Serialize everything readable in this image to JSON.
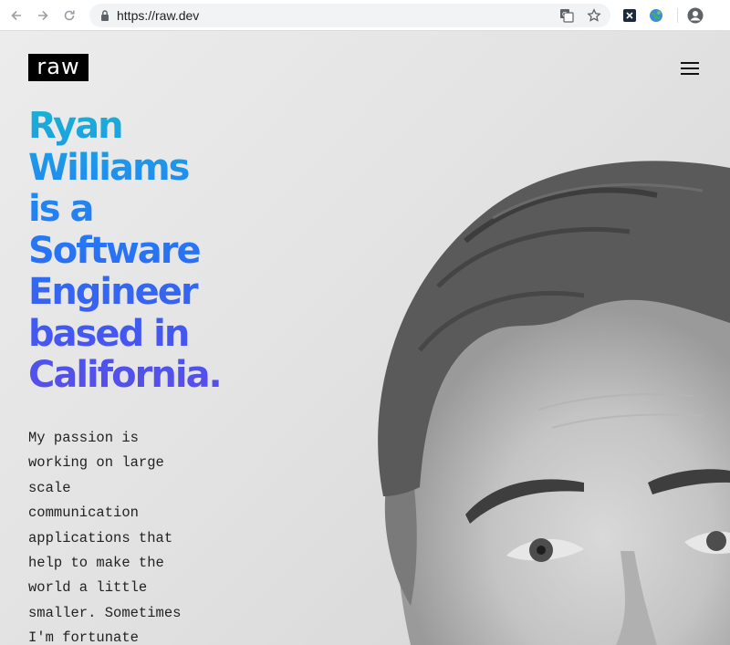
{
  "browser": {
    "url": "https://raw.dev"
  },
  "site": {
    "logo": "raw"
  },
  "hero": {
    "headline_lines": [
      "Ryan",
      "Williams",
      "is a",
      "Software",
      "Engineer",
      "based in",
      "California."
    ],
    "bio_lines": [
      "My passion is",
      "working on large",
      "scale",
      "communication",
      "applications that",
      "help to make the",
      "world a little",
      "smaller. Sometimes",
      "I'm fortunate"
    ]
  },
  "icons": {
    "back": "arrow-left-icon",
    "forward": "arrow-right-icon",
    "reload": "reload-icon",
    "lock": "lock-icon",
    "translate": "translate-icon",
    "bookmark": "star-icon",
    "extension1": "x-extension-icon",
    "extension2": "globe-extension-icon",
    "profile": "profile-icon",
    "menu": "hamburger-menu-icon"
  },
  "colors": {
    "gradient_top": "#19b3d3",
    "gradient_bottom": "#5a4ee8",
    "logo_bg": "#000000"
  }
}
